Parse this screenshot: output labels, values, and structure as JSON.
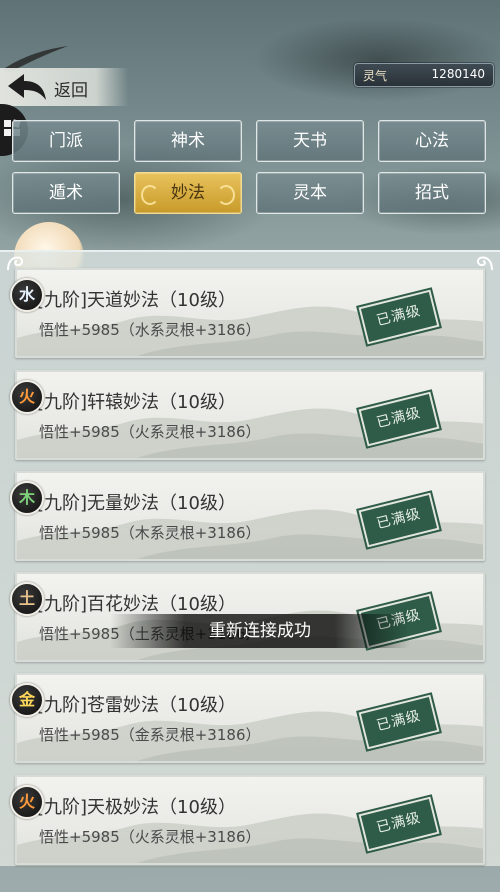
{
  "header": {
    "back_label": "返回",
    "currency": {
      "name": "灵气",
      "value": "1280140"
    }
  },
  "tabs": [
    {
      "label": "门派",
      "active": false
    },
    {
      "label": "神术",
      "active": false
    },
    {
      "label": "天书",
      "active": false
    },
    {
      "label": "心法",
      "active": false
    },
    {
      "label": "遁术",
      "active": false
    },
    {
      "label": "妙法",
      "active": true
    },
    {
      "label": "灵本",
      "active": false
    },
    {
      "label": "招式",
      "active": false
    }
  ],
  "skills": [
    {
      "element": "水",
      "element_color": "#e8f2ff",
      "title": "[九阶]天道妙法（10级）",
      "stats": "悟性+5985（水系灵根+3186）",
      "status": "已满级"
    },
    {
      "element": "火",
      "element_color": "#ff9a3a",
      "title": "[九阶]轩辕妙法（10级）",
      "stats": "悟性+5985（火系灵根+3186）",
      "status": "已满级"
    },
    {
      "element": "木",
      "element_color": "#7ed07a",
      "title": "[九阶]无量妙法（10级）",
      "stats": "悟性+5985（木系灵根+3186）",
      "status": "已满级"
    },
    {
      "element": "土",
      "element_color": "#e7c08a",
      "title": "[九阶]百花妙法（10级）",
      "stats": "悟性+5985（土系灵根+3186）",
      "status": "已满级"
    },
    {
      "element": "金",
      "element_color": "#ffd85a",
      "title": "[九阶]苍雷妙法（10级）",
      "stats": "悟性+5985（金系灵根+3186）",
      "status": "已满级"
    },
    {
      "element": "火",
      "element_color": "#ff9a3a",
      "title": "[九阶]天极妙法（10级）",
      "stats": "悟性+5985（火系灵根+3186）",
      "status": "已满级"
    }
  ],
  "toast": "重新连接成功",
  "icons": {
    "back": "back-arrow-icon",
    "menu": "menu-emblem-icon",
    "scroll": "cloud-scroll-ornament"
  }
}
